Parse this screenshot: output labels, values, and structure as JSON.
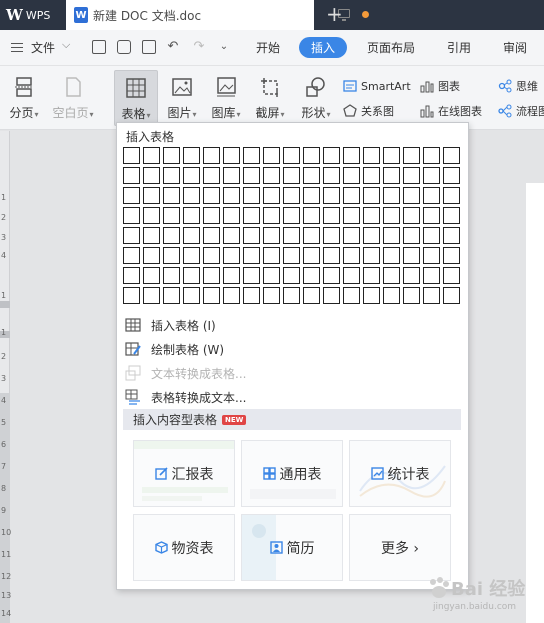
{
  "titlebar": {
    "app_name": "WPS",
    "doc_title": "新建 DOC 文档.doc",
    "new_tab": "+"
  },
  "menubar": {
    "file": "文件",
    "tabs": [
      "开始",
      "插入",
      "页面布局",
      "引用",
      "审阅"
    ],
    "active_tab": "插入"
  },
  "ribbon": {
    "buttons": [
      "分页",
      "空白页",
      "表格",
      "图片",
      "图库",
      "截屏",
      "形状"
    ],
    "small": [
      "SmartArt",
      "图表",
      "思维",
      "关系图",
      "在线图表",
      "流程图"
    ]
  },
  "ruler": {
    "ticks": [
      "1",
      "2",
      "3",
      "4",
      "1",
      "1",
      "2",
      "3",
      "4",
      "5",
      "6",
      "7",
      "8",
      "9",
      "10",
      "11",
      "12",
      "13",
      "14"
    ]
  },
  "dropdown": {
    "header": "插入表格",
    "grid": {
      "cols": 17,
      "rows": 8
    },
    "menu": [
      {
        "label": "插入表格 (I)",
        "icon": "table-icon",
        "disabled": false
      },
      {
        "label": "绘制表格 (W)",
        "icon": "draw-table-icon",
        "disabled": false
      },
      {
        "label": "文本转换成表格...",
        "icon": "text-to-table-icon",
        "disabled": true
      },
      {
        "label": "表格转换成文本...",
        "icon": "table-to-text-icon",
        "disabled": false
      }
    ],
    "content_table": {
      "label": "插入内容型表格",
      "badge": "NEW"
    },
    "cards": [
      {
        "label": "汇报表",
        "icon": "edit-icon"
      },
      {
        "label": "通用表",
        "icon": "grid-icon"
      },
      {
        "label": "统计表",
        "icon": "chart-icon"
      },
      {
        "label": "物资表",
        "icon": "box-icon"
      },
      {
        "label": "简历",
        "icon": "profile-icon"
      },
      {
        "label": "更多 ›",
        "icon": ""
      }
    ]
  },
  "watermark": {
    "text": "Bai 经验",
    "url": "jingyan.baidu.com"
  },
  "colors": {
    "titlebar": "#2c3442",
    "accent": "#3a86e6",
    "badge": "#e04545",
    "wps_icon": "#2f6fd6"
  }
}
